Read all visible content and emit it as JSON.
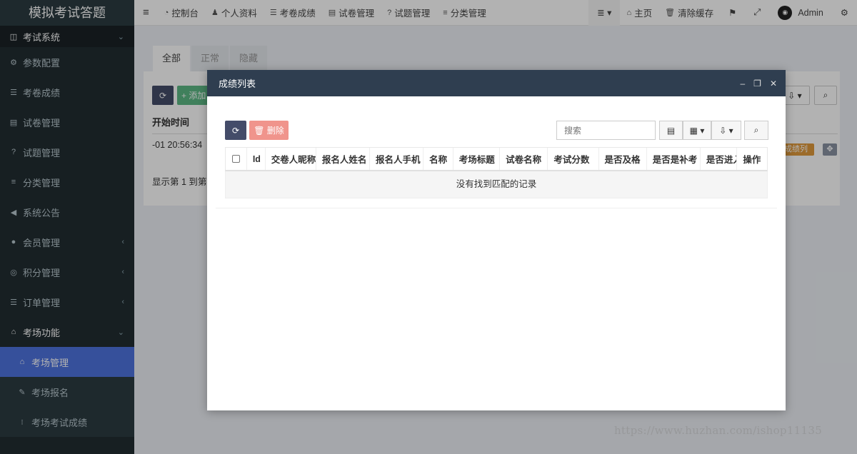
{
  "sidebar": {
    "logo": "模拟考试答题",
    "items": [
      {
        "label": "考试系统",
        "icon": "panel-icon",
        "glyph": "◫",
        "type": "header",
        "arrow": "⌄"
      },
      {
        "label": "参数配置",
        "icon": "cogs-icon",
        "glyph": "⚙",
        "type": "item"
      },
      {
        "label": "考卷成绩",
        "icon": "list-icon",
        "glyph": "☰",
        "type": "item"
      },
      {
        "label": "试卷管理",
        "icon": "newspaper-icon",
        "glyph": "▤",
        "type": "item"
      },
      {
        "label": "试题管理",
        "icon": "question-circle-icon",
        "glyph": "?",
        "type": "item"
      },
      {
        "label": "分类管理",
        "icon": "align-left-icon",
        "glyph": "≡",
        "type": "item"
      },
      {
        "label": "系统公告",
        "icon": "volume-icon",
        "glyph": "◀",
        "type": "item"
      },
      {
        "label": "会员管理",
        "icon": "user-circle-icon",
        "glyph": "●",
        "type": "item",
        "arrow": "‹"
      },
      {
        "label": "积分管理",
        "icon": "life-ring-icon",
        "glyph": "◎",
        "type": "item",
        "arrow": "‹"
      },
      {
        "label": "订单管理",
        "icon": "list-ul-icon",
        "glyph": "☰",
        "type": "item",
        "arrow": "‹"
      },
      {
        "label": "考场功能",
        "icon": "home-icon",
        "glyph": "⌂",
        "type": "header",
        "arrow": "⌄"
      }
    ],
    "submenu": [
      {
        "label": "考场管理",
        "icon": "home-icon",
        "glyph": "⌂",
        "active": true
      },
      {
        "label": "考场报名",
        "icon": "pencil-icon",
        "glyph": "✎",
        "active": false
      },
      {
        "label": "考场考试成绩",
        "icon": "list-ol-icon",
        "glyph": "⁝",
        "active": false
      }
    ]
  },
  "topbar": {
    "menu_toggle": "≡",
    "items": [
      {
        "label": "控制台",
        "icon": "dashboard-icon",
        "glyph": "◔"
      },
      {
        "label": "个人资料",
        "icon": "user-icon",
        "glyph": "♟"
      },
      {
        "label": "考卷成绩",
        "icon": "list-icon",
        "glyph": "☰"
      },
      {
        "label": "试卷管理",
        "icon": "newspaper-icon",
        "glyph": "▤"
      },
      {
        "label": "试题管理",
        "icon": "question-circle-icon",
        "glyph": "?"
      },
      {
        "label": "分类管理",
        "icon": "align-left-icon",
        "glyph": "≡"
      }
    ],
    "more": "≣ ▾",
    "home_label": "主页",
    "home_glyph": "⌂",
    "clear_cache_label": "清除缓存",
    "clear_cache_glyph": "🗑",
    "lang_glyph": "⚑",
    "fullscreen_glyph": "⤢",
    "user_name": "Admin",
    "settings_glyph": "⚙"
  },
  "background_page": {
    "tabs": [
      "全部",
      "正常",
      "隐藏"
    ],
    "add_label": "+ 添加",
    "column_header": "开始时间",
    "row_time": "-01 20:56:34",
    "footer": "显示第 1 到第",
    "row_button": "成绩列表",
    "move_glyph": "✥"
  },
  "modal": {
    "title": "成绩列表",
    "minimize": "–",
    "maximize": "❐",
    "close": "✕",
    "refresh_glyph": "⟳",
    "delete_label": "🗑 删除",
    "search_placeholder": "搜索",
    "toggle_view_glyph": "▤",
    "columns_glyph": "▦ ▾",
    "export_glyph": "⇩ ▾",
    "search_glyph": "⌕",
    "columns": [
      "Id",
      "交卷人昵称",
      "报名人姓名",
      "报名人手机",
      "名称",
      "考场标题",
      "试卷名称",
      "考试分数",
      "是否及格",
      "是否是补考",
      "是否进入",
      "操作"
    ],
    "empty_text": "没有找到匹配的记录"
  },
  "watermark": "https://www.huzhan.com/ishop11135"
}
